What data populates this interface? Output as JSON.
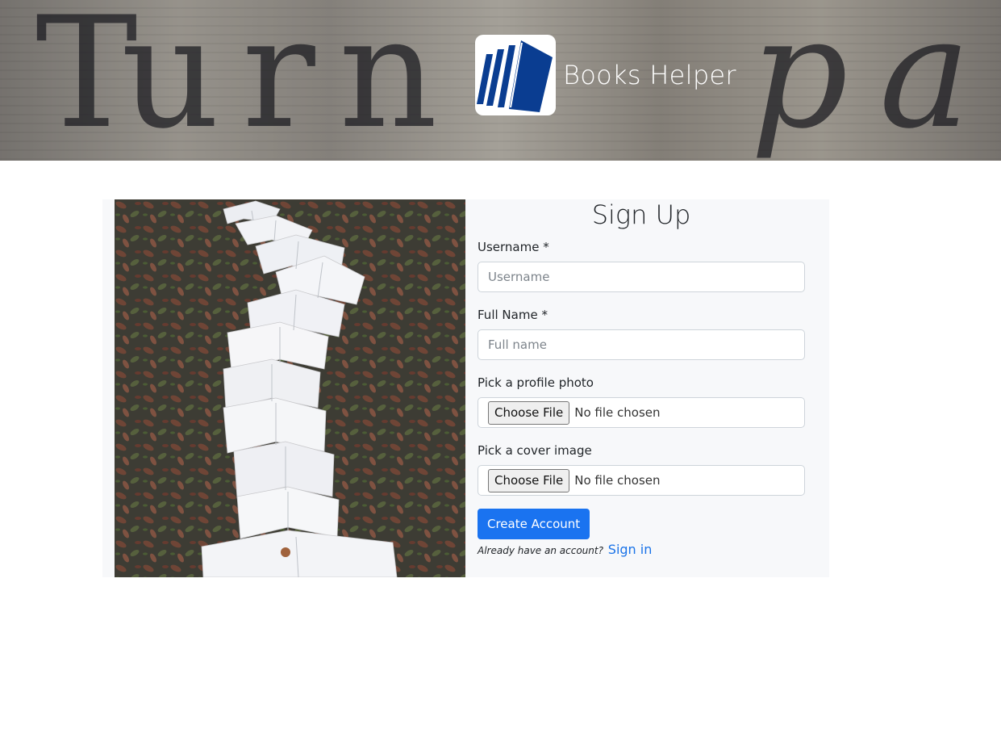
{
  "brand": {
    "name": "Books Helper",
    "logo_icon": "books-logo-icon"
  },
  "signup": {
    "title": "Sign Up",
    "username": {
      "label": "Username *",
      "placeholder": "Username",
      "value": ""
    },
    "fullname": {
      "label": "Full Name *",
      "placeholder": "Full name",
      "value": ""
    },
    "profile_photo": {
      "label": "Pick a profile photo",
      "button": "Choose File",
      "status": "No file chosen"
    },
    "cover_image": {
      "label": "Pick a cover image",
      "button": "Choose File",
      "status": "No file chosen"
    },
    "submit_label": "Create Account",
    "have_account_text": "Already have an account?",
    "signin_link": "Sign in"
  },
  "colors": {
    "primary": "#1a73f0",
    "link": "#1a73e8",
    "logo_blue": "#0a3d91",
    "panel_bg": "#f7f8fa"
  }
}
